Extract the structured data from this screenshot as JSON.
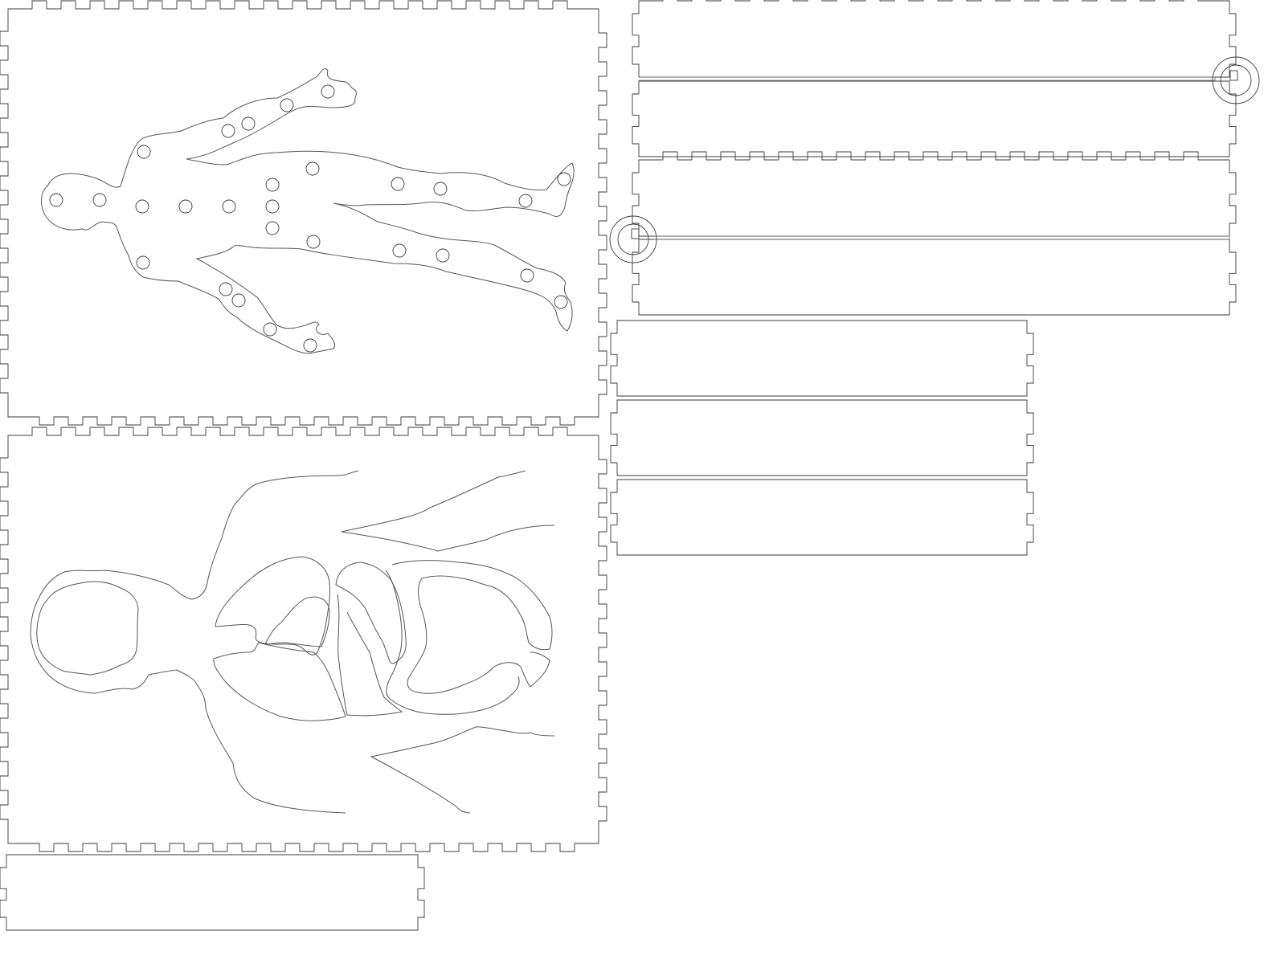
{
  "sheet": {
    "panels": [
      {
        "id": "body-outline-lid",
        "kind": "box-face",
        "engraving": "human-body-with-circles"
      },
      {
        "id": "organs-panel",
        "kind": "box-face",
        "engraving": "torso-with-organs"
      },
      {
        "id": "side-wall-bottom-left",
        "kind": "finger-joint-strip"
      },
      {
        "id": "hinged-strip-top",
        "kind": "finger-joint-strip",
        "hinge": true
      },
      {
        "id": "hinged-strip-upper",
        "kind": "finger-joint-strip"
      },
      {
        "id": "hinged-strip-middle",
        "kind": "finger-joint-strip",
        "hinge": true
      },
      {
        "id": "hinged-strip-lower",
        "kind": "finger-joint-strip"
      },
      {
        "id": "short-strip-1",
        "kind": "finger-joint-strip"
      },
      {
        "id": "short-strip-2",
        "kind": "finger-joint-strip"
      },
      {
        "id": "short-strip-3",
        "kind": "finger-joint-strip"
      }
    ],
    "colors": {
      "cut": "#3a3a3a",
      "engrave": "#555555",
      "background": "#ffffff"
    }
  }
}
